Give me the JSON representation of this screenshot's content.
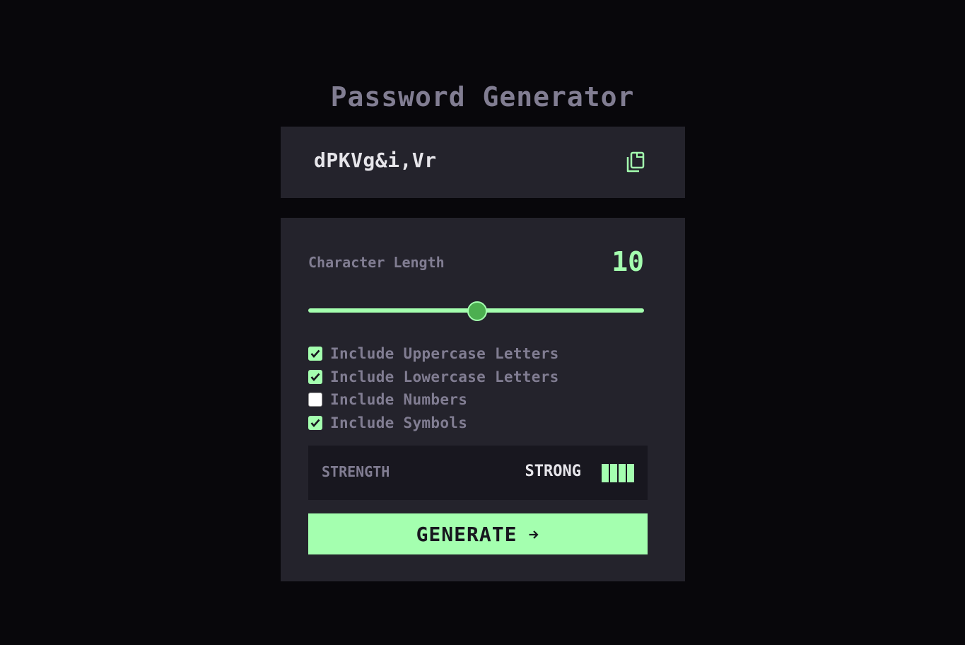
{
  "header": {
    "title": "Password Generator"
  },
  "password": {
    "value": "dPKVg&i,Vr",
    "copy_icon": "copy-icon"
  },
  "length": {
    "label": "Character Length",
    "value": "10",
    "slider_fraction": 0.5
  },
  "options": [
    {
      "label": "Include Uppercase Letters",
      "checked": true
    },
    {
      "label": "Include Lowercase Letters",
      "checked": true
    },
    {
      "label": "Include Numbers",
      "checked": false
    },
    {
      "label": "Include Symbols",
      "checked": true
    }
  ],
  "strength": {
    "label": "STRENGTH",
    "value": "STRONG",
    "level": 4,
    "max_level": 4
  },
  "generate": {
    "label": "GENERATE",
    "icon": "arrow-right-icon"
  },
  "colors": {
    "accent": "#a4ffaf",
    "background": "#08070b",
    "panel": "#24232c",
    "muted_text": "#817d92",
    "light_text": "#e6e5ea",
    "slider_thumb": "#4caf50"
  }
}
